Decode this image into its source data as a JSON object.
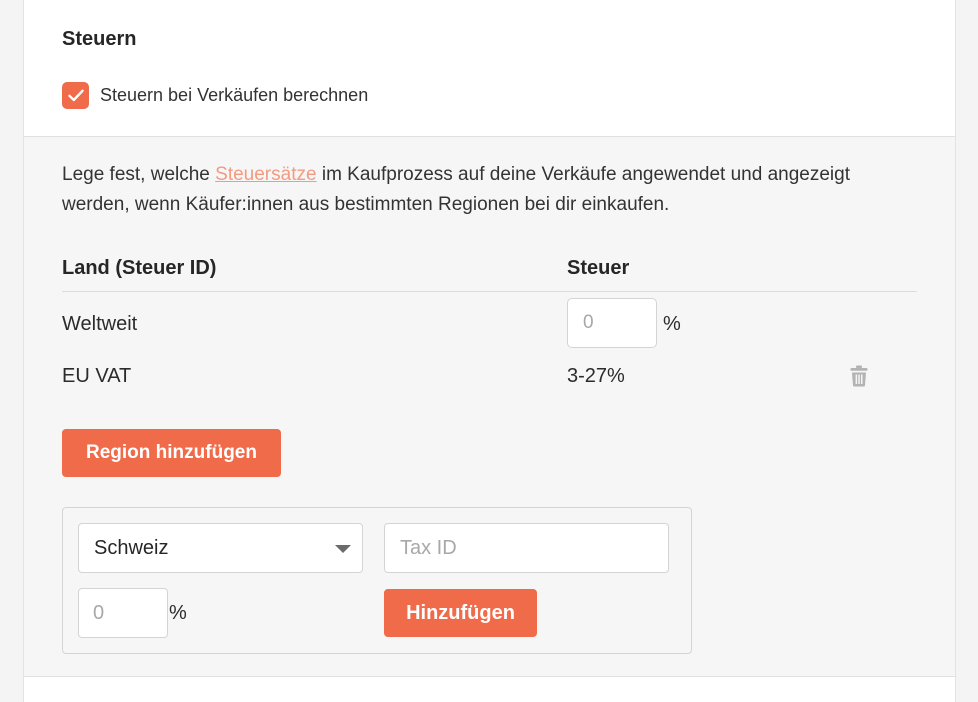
{
  "header": {
    "title": "Steuern",
    "checkbox_label": "Steuern bei Verkäufen berechnen",
    "checkbox_checked": true
  },
  "description": {
    "before": "Lege fest, welche ",
    "link": "Steuersätze",
    "after": " im Kaufprozess auf deine Verkäufe angewendet und angezeigt werden, wenn Käufer:innen aus bestimmten Regionen bei dir einkaufen."
  },
  "table": {
    "col_country": "Land (Steuer ID)",
    "col_tax": "Steuer",
    "rows": [
      {
        "country": "Weltweit",
        "rate_placeholder": "0",
        "unit": "%"
      },
      {
        "country": "EU VAT",
        "rate": "3-27%"
      }
    ]
  },
  "add_region_button": "Region hinzufügen",
  "add_form": {
    "country_selected": "Schweiz",
    "taxid_placeholder": "Tax ID",
    "rate_placeholder": "0",
    "unit": "%",
    "submit_label": "Hinzufügen"
  },
  "colors": {
    "accent": "#ef6b4a",
    "link": "#f29b82"
  }
}
